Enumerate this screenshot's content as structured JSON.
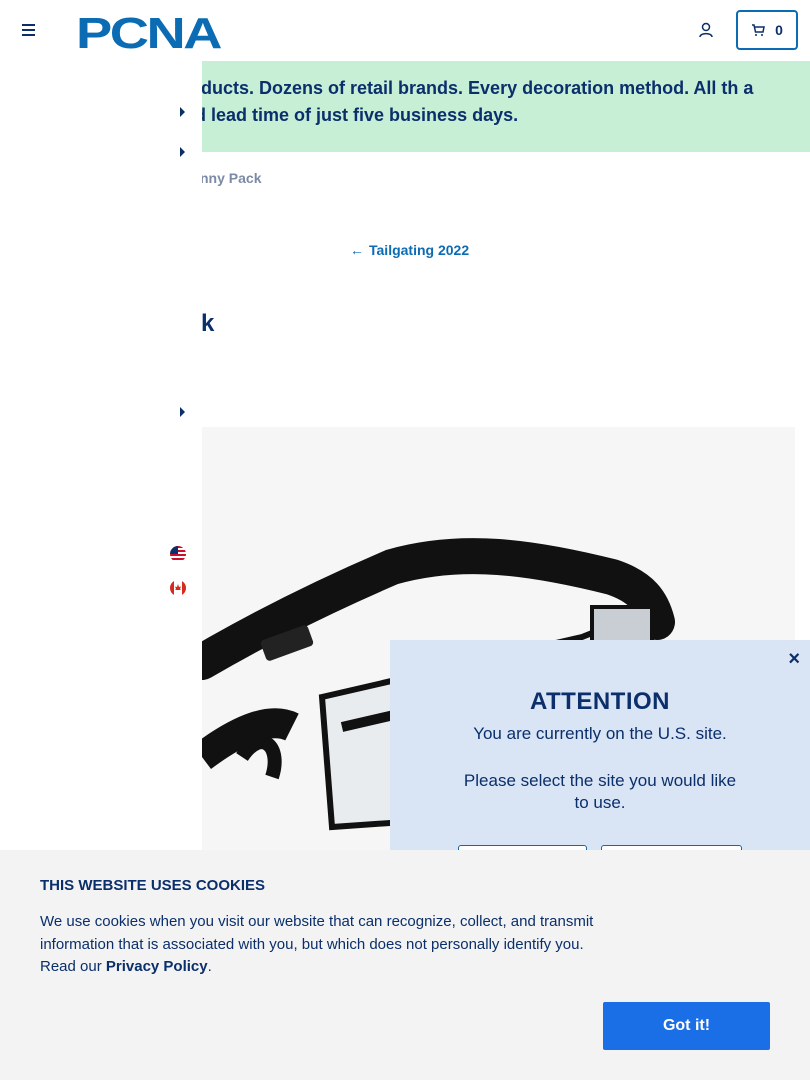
{
  "header": {
    "logo_text": "PCNA",
    "cart_count": "0"
  },
  "banner": {
    "text": "ls of products. Dozens of retail brands. Every decoration method. All th a standard lead time of just five business days."
  },
  "breadcrumb": {
    "current": "nny Pack"
  },
  "back_link": {
    "label": "Tailgating 2022"
  },
  "product": {
    "title_fragment": "k"
  },
  "modal": {
    "title": "ATTENTION",
    "line1": "You are currently on the U.S. site.",
    "line2": "Please select the site you would like to use.",
    "close": "×"
  },
  "cookie": {
    "title": "THIS WEBSITE USES COOKIES",
    "message": "We use cookies when you visit our website that can recognize, collect, and transmit information that is associated with you, but which does not personally identify you. Read our ",
    "link": "Privacy Policy",
    "suffix": ".",
    "button": "Got it!"
  },
  "colors": {
    "navy": "#0b2f6b",
    "accent_blue": "#0b6cb4",
    "banner_green": "#c6efd6",
    "modal_bg": "#d9e4f5",
    "button_blue": "#1a6ee6"
  }
}
